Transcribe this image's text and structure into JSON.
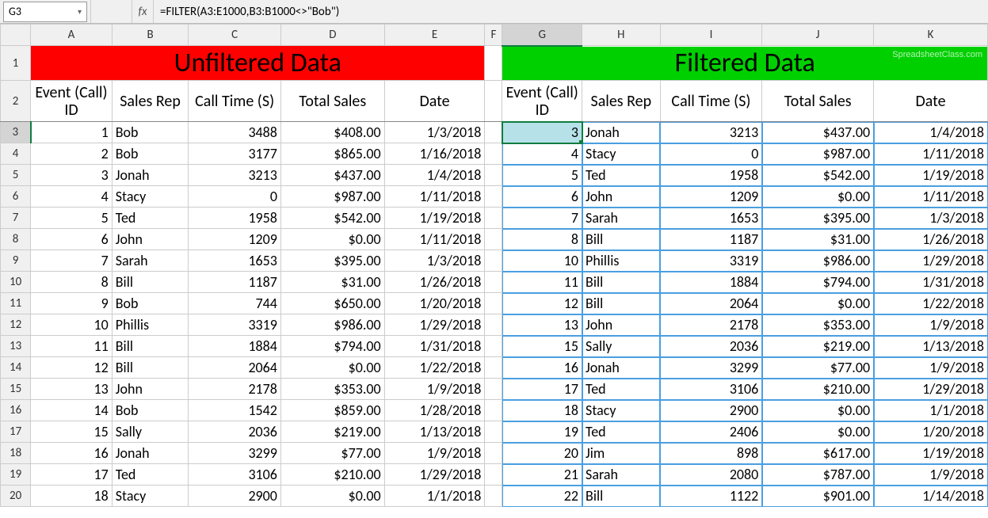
{
  "nameBox": "G3",
  "fxSymbol": "fx",
  "formula": "=FILTER(A3:E1000,B3:B1000<>\"Bob\")",
  "watermark": "SpreadsheetClass.com",
  "colHeaders": [
    "A",
    "B",
    "C",
    "D",
    "E",
    "F",
    "G",
    "H",
    "I",
    "J",
    "K"
  ],
  "rowHeaders": [
    "1",
    "2",
    "3",
    "4",
    "5",
    "6",
    "7",
    "8",
    "9",
    "10",
    "11",
    "12",
    "13",
    "14",
    "15",
    "16",
    "17",
    "18",
    "19",
    "20"
  ],
  "titles": {
    "left": "Unfiltered Data",
    "right": "Filtered Data"
  },
  "headerRow": [
    "Event (Call) ID",
    "Sales Rep",
    "Call Time (S)",
    "Total Sales",
    "Date",
    "",
    "Event (Call) ID",
    "Sales Rep",
    "Call Time (S)",
    "Total Sales",
    "Date"
  ],
  "leftData": [
    {
      "id": "1",
      "rep": "Bob",
      "time": "3488",
      "sales": "$408.00",
      "date": "1/3/2018"
    },
    {
      "id": "2",
      "rep": "Bob",
      "time": "3177",
      "sales": "$865.00",
      "date": "1/16/2018"
    },
    {
      "id": "3",
      "rep": "Jonah",
      "time": "3213",
      "sales": "$437.00",
      "date": "1/4/2018"
    },
    {
      "id": "4",
      "rep": "Stacy",
      "time": "0",
      "sales": "$987.00",
      "date": "1/11/2018"
    },
    {
      "id": "5",
      "rep": "Ted",
      "time": "1958",
      "sales": "$542.00",
      "date": "1/19/2018"
    },
    {
      "id": "6",
      "rep": "John",
      "time": "1209",
      "sales": "$0.00",
      "date": "1/11/2018"
    },
    {
      "id": "7",
      "rep": "Sarah",
      "time": "1653",
      "sales": "$395.00",
      "date": "1/3/2018"
    },
    {
      "id": "8",
      "rep": "Bill",
      "time": "1187",
      "sales": "$31.00",
      "date": "1/26/2018"
    },
    {
      "id": "9",
      "rep": "Bob",
      "time": "744",
      "sales": "$650.00",
      "date": "1/20/2018"
    },
    {
      "id": "10",
      "rep": "Phillis",
      "time": "3319",
      "sales": "$986.00",
      "date": "1/29/2018"
    },
    {
      "id": "11",
      "rep": "Bill",
      "time": "1884",
      "sales": "$794.00",
      "date": "1/31/2018"
    },
    {
      "id": "12",
      "rep": "Bill",
      "time": "2064",
      "sales": "$0.00",
      "date": "1/22/2018"
    },
    {
      "id": "13",
      "rep": "John",
      "time": "2178",
      "sales": "$353.00",
      "date": "1/9/2018"
    },
    {
      "id": "14",
      "rep": "Bob",
      "time": "1542",
      "sales": "$859.00",
      "date": "1/28/2018"
    },
    {
      "id": "15",
      "rep": "Sally",
      "time": "2036",
      "sales": "$219.00",
      "date": "1/13/2018"
    },
    {
      "id": "16",
      "rep": "Jonah",
      "time": "3299",
      "sales": "$77.00",
      "date": "1/9/2018"
    },
    {
      "id": "17",
      "rep": "Ted",
      "time": "3106",
      "sales": "$210.00",
      "date": "1/29/2018"
    },
    {
      "id": "18",
      "rep": "Stacy",
      "time": "2900",
      "sales": "$0.00",
      "date": "1/1/2018"
    }
  ],
  "rightData": [
    {
      "id": "3",
      "rep": "Jonah",
      "time": "3213",
      "sales": "$437.00",
      "date": "1/4/2018"
    },
    {
      "id": "4",
      "rep": "Stacy",
      "time": "0",
      "sales": "$987.00",
      "date": "1/11/2018"
    },
    {
      "id": "5",
      "rep": "Ted",
      "time": "1958",
      "sales": "$542.00",
      "date": "1/19/2018"
    },
    {
      "id": "6",
      "rep": "John",
      "time": "1209",
      "sales": "$0.00",
      "date": "1/11/2018"
    },
    {
      "id": "7",
      "rep": "Sarah",
      "time": "1653",
      "sales": "$395.00",
      "date": "1/3/2018"
    },
    {
      "id": "8",
      "rep": "Bill",
      "time": "1187",
      "sales": "$31.00",
      "date": "1/26/2018"
    },
    {
      "id": "10",
      "rep": "Phillis",
      "time": "3319",
      "sales": "$986.00",
      "date": "1/29/2018"
    },
    {
      "id": "11",
      "rep": "Bill",
      "time": "1884",
      "sales": "$794.00",
      "date": "1/31/2018"
    },
    {
      "id": "12",
      "rep": "Bill",
      "time": "2064",
      "sales": "$0.00",
      "date": "1/22/2018"
    },
    {
      "id": "13",
      "rep": "John",
      "time": "2178",
      "sales": "$353.00",
      "date": "1/9/2018"
    },
    {
      "id": "15",
      "rep": "Sally",
      "time": "2036",
      "sales": "$219.00",
      "date": "1/13/2018"
    },
    {
      "id": "16",
      "rep": "Jonah",
      "time": "3299",
      "sales": "$77.00",
      "date": "1/9/2018"
    },
    {
      "id": "17",
      "rep": "Ted",
      "time": "3106",
      "sales": "$210.00",
      "date": "1/29/2018"
    },
    {
      "id": "18",
      "rep": "Stacy",
      "time": "2900",
      "sales": "$0.00",
      "date": "1/1/2018"
    },
    {
      "id": "19",
      "rep": "Ted",
      "time": "2406",
      "sales": "$0.00",
      "date": "1/20/2018"
    },
    {
      "id": "20",
      "rep": "Jim",
      "time": "898",
      "sales": "$617.00",
      "date": "1/19/2018"
    },
    {
      "id": "21",
      "rep": "Sarah",
      "time": "2080",
      "sales": "$787.00",
      "date": "1/9/2018"
    },
    {
      "id": "22",
      "rep": "Bill",
      "time": "1122",
      "sales": "$901.00",
      "date": "1/14/2018"
    }
  ],
  "selectedCell": {
    "row": 3,
    "col": "G"
  }
}
